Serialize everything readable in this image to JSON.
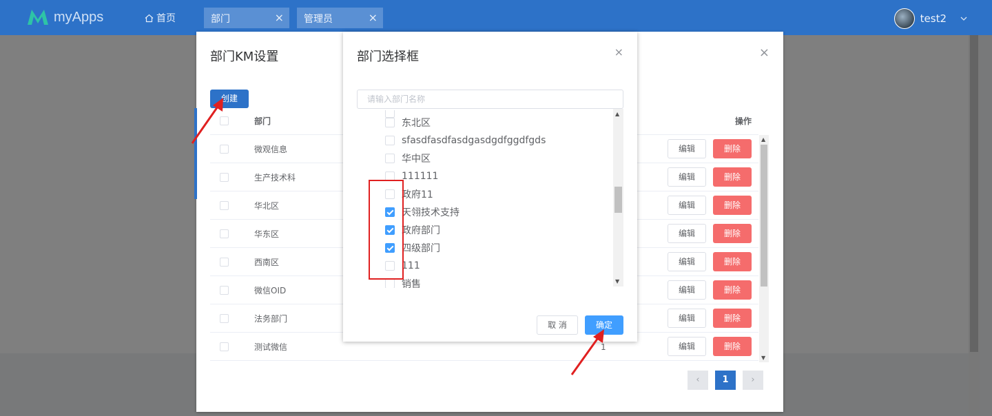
{
  "header": {
    "app_name": "myApps",
    "home_label": "首页",
    "tabs": [
      {
        "label": "部门",
        "close": "×"
      },
      {
        "label": "管理员",
        "close": "×"
      }
    ],
    "user_name": "test2"
  },
  "km_dialog": {
    "title": "部门KM设置",
    "close": "×",
    "create_label": "创建",
    "columns": {
      "dept": "部门",
      "ops": "操作"
    },
    "rows": [
      {
        "name": "微观信息"
      },
      {
        "name": "生产技术科"
      },
      {
        "name": "华北区"
      },
      {
        "name": "华东区"
      },
      {
        "name": "西南区"
      },
      {
        "name": "微信OID"
      },
      {
        "name": "法务部门"
      },
      {
        "name": "测试微信"
      }
    ],
    "partial_value": "1",
    "edit_label": "编辑",
    "delete_label": "删除",
    "pager": {
      "prev": "‹",
      "current": "1",
      "next": "›"
    }
  },
  "dept_dialog": {
    "title": "部门选择框",
    "close": "×",
    "search_placeholder": "请输入部门名称",
    "nodes": [
      {
        "label": "东北区",
        "checked": false
      },
      {
        "label": "sfasdfasdfasdgasdgdfggdfgds",
        "checked": false
      },
      {
        "label": "华中区",
        "checked": false
      },
      {
        "label": "111111",
        "checked": false
      },
      {
        "label": "政府11",
        "checked": false
      },
      {
        "label": "天翎技术支持",
        "checked": true
      },
      {
        "label": "政府部门",
        "checked": true
      },
      {
        "label": "四级部门",
        "checked": true
      },
      {
        "label": "111",
        "checked": false
      },
      {
        "label": "销售",
        "checked": false
      }
    ],
    "cancel_label": "取 消",
    "ok_label": "确定"
  },
  "colors": {
    "header_bg": "#2d72c8",
    "primary": "#409eff",
    "danger": "#f56c6c",
    "annotation": "#e02020"
  }
}
